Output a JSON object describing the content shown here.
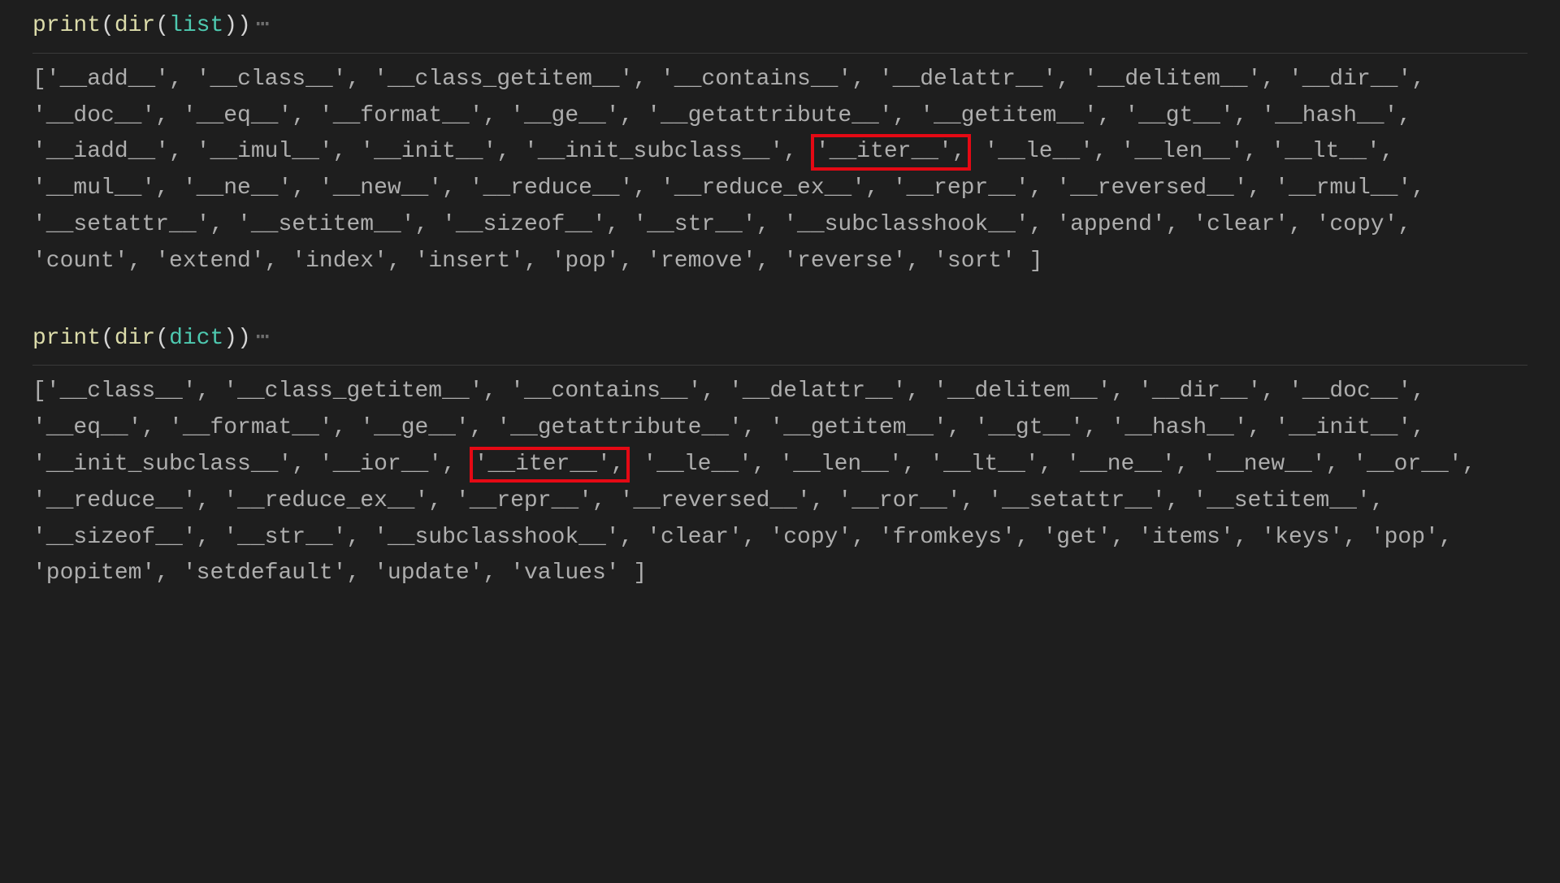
{
  "cell1": {
    "code": {
      "fn1": "print",
      "lp1": "(",
      "fn2": "dir",
      "lp2": "(",
      "arg": "list",
      "rp2": ")",
      "rp1": ")",
      "fold": "⋯"
    },
    "output": {
      "open": "[",
      "close": "]",
      "items": [
        "'__add__'",
        "'__class__'",
        "'__class_getitem__'",
        "'__contains__'",
        "'__delattr__'",
        "'__delitem__'",
        "'__dir__'",
        "'__doc__'",
        "'__eq__'",
        "'__format__'",
        "'__ge__'",
        "'__getattribute__'",
        "'__getitem__'",
        "'__gt__'",
        "'__hash__'",
        "'__iadd__'",
        "'__imul__'",
        "'__init__'",
        "'__init_subclass__'",
        "'__iter__'",
        "'__le__'",
        "'__len__'",
        "'__lt__'",
        "'__mul__'",
        "'__ne__'",
        "'__new__'",
        "'__reduce__'",
        "'__reduce_ex__'",
        "'__repr__'",
        "'__reversed__'",
        "'__rmul__'",
        "'__setattr__'",
        "'__setitem__'",
        "'__sizeof__'",
        "'__str__'",
        "'__subclasshook__'",
        "'append'",
        "'clear'",
        "'copy'",
        "'count'",
        "'extend'",
        "'index'",
        "'insert'",
        "'pop'",
        "'remove'",
        "'reverse'",
        "'sort'"
      ],
      "highlight_index": 19
    }
  },
  "cell2": {
    "code": {
      "fn1": "print",
      "lp1": "(",
      "fn2": "dir",
      "lp2": "(",
      "arg": "dict",
      "rp2": ")",
      "rp1": ")",
      "fold": "⋯"
    },
    "output": {
      "open": "[",
      "close": "]",
      "items": [
        "'__class__'",
        "'__class_getitem__'",
        "'__contains__'",
        "'__delattr__'",
        "'__delitem__'",
        "'__dir__'",
        "'__doc__'",
        "'__eq__'",
        "'__format__'",
        "'__ge__'",
        "'__getattribute__'",
        "'__getitem__'",
        "'__gt__'",
        "'__hash__'",
        "'__init__'",
        "'__init_subclass__'",
        "'__ior__'",
        "'__iter__'",
        "'__le__'",
        "'__len__'",
        "'__lt__'",
        "'__ne__'",
        "'__new__'",
        "'__or__'",
        "'__reduce__'",
        "'__reduce_ex__'",
        "'__repr__'",
        "'__reversed__'",
        "'__ror__'",
        "'__setattr__'",
        "'__setitem__'",
        "'__sizeof__'",
        "'__str__'",
        "'__subclasshook__'",
        "'clear'",
        "'copy'",
        "'fromkeys'",
        "'get'",
        "'items'",
        "'keys'",
        "'pop'",
        "'popitem'",
        "'setdefault'",
        "'update'",
        "'values'"
      ],
      "highlight_index": 17
    }
  }
}
